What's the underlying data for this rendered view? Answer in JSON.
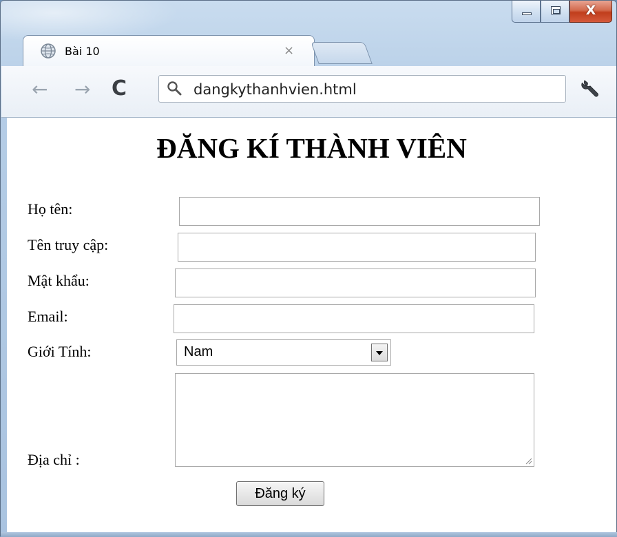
{
  "tab": {
    "title": "Bài 10",
    "close_glyph": "×",
    "favicon": "globe-icon"
  },
  "toolbar": {
    "back_glyph": "←",
    "forward_glyph": "→",
    "reload_glyph": "C",
    "address": "dangkythanhvien.html",
    "search_icon": "search-icon",
    "menu_icon": "wrench-icon"
  },
  "window": {
    "close_glyph": "X",
    "close_color": "#c9452a"
  },
  "form": {
    "title": "ĐĂNG KÍ THÀNH VIÊN",
    "fields": {
      "fullname_label": "Họ tên:",
      "username_label": "Tên truy cập:",
      "password_label": "Mật khẩu:",
      "email_label": "Email:",
      "gender_label": "Giới Tính:",
      "gender_value": "Nam",
      "address_label": "Địa chỉ :"
    },
    "submit_label": "Đăng ký"
  }
}
